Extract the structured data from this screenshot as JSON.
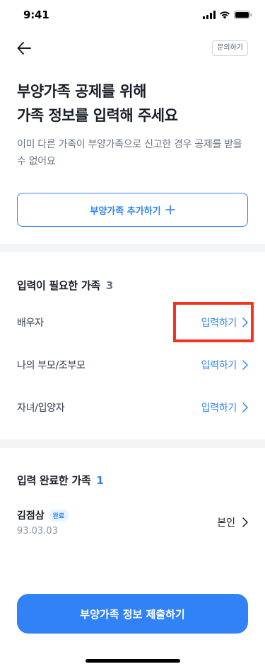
{
  "status_bar": {
    "time": "9:41"
  },
  "nav": {
    "inquiry_label": "문의하기"
  },
  "header": {
    "title_line1": "부양가족 공제를 위해",
    "title_line2": "가족 정보를 입력해 주세요",
    "subtitle": "이미 다른 가족이 부양가족으로 신고한 경우 공제를 받을 수 없어요"
  },
  "add_button": {
    "label": "부양가족 추가하기",
    "icon": "plus-icon"
  },
  "needed": {
    "title": "입력이 필요한 가족",
    "count": "3",
    "items": [
      {
        "name": "배우자",
        "action": "입력하기"
      },
      {
        "name": "나의 부모/조부모",
        "action": "입력하기"
      },
      {
        "name": "자녀/입양자",
        "action": "입력하기"
      }
    ]
  },
  "completed": {
    "title": "입력 완료한 가족",
    "count": "1",
    "items": [
      {
        "name": "김점삼",
        "badge": "완료",
        "date": "93.03.03",
        "relation": "본인"
      }
    ]
  },
  "submit": {
    "label": "부양가족 정보 제출하기"
  },
  "colors": {
    "accent": "#3182f6",
    "highlight": "#f5331f",
    "divider": "#f2f4f6"
  }
}
